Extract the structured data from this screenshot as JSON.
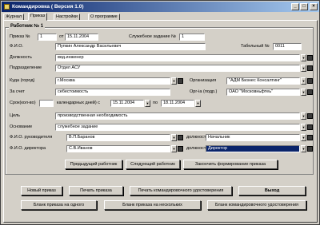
{
  "window": {
    "title": "Командировка ( Версия 1.0)"
  },
  "tabs": [
    "Журнал",
    "Приказ",
    "Настройки",
    "О программе"
  ],
  "group_title": "Работник № 1",
  "order": {
    "num_label": "Приказ №",
    "num": "1",
    "from_label": "от",
    "date": "15.11.2004",
    "task_label": "Служебное задание №",
    "task_num": "1"
  },
  "employee": {
    "fio_label": "Ф.И.О.",
    "fio": "Пупкин Александр Васильевич",
    "tab_label": "Табельный №",
    "tab_num": "0011"
  },
  "position": {
    "label": "Должность",
    "value": "вед.инженер"
  },
  "department": {
    "label": "Подразделение",
    "value": "Отдел АСУ"
  },
  "where": {
    "label": "Куда (город)",
    "value": "г.Москва",
    "org_label": "Организация",
    "org": "\"АДМ Бизнес Консалтинг\""
  },
  "payer": {
    "label": "За счет",
    "value": "себестоимость",
    "org2_label": "Орг-ia (подр.)",
    "org2": "ОАО \"Московньфтеь\""
  },
  "period": {
    "label": "Срок(кол-во)",
    "days": "",
    "days_label": "календарных дней) с",
    "from": "15.11.2004",
    "to_label": "по",
    "to": "18.11.2004"
  },
  "goal": {
    "label": "Цель",
    "value": "производственная необходимость"
  },
  "basis": {
    "label": "Основание",
    "value": "служебное задание"
  },
  "head": {
    "label": "Ф.И.О. руководителя",
    "value": "В.П.Баранов",
    "pos_label": "должность",
    "pos": "Начальник"
  },
  "director": {
    "label": "Ф.И.О. директора",
    "value": "С.В.Иванов",
    "pos_label": "должность",
    "pos": "Директор"
  },
  "nav_buttons": {
    "prev": "Предыдущий работник",
    "next": "Следующий работник",
    "finish": "Закончить формирование приказа"
  },
  "bottom_buttons": {
    "new_order": "Новый приказ",
    "print_order": "Печать приказа",
    "print_cert": "Печать командировочного удостоверения",
    "exit": "Выход",
    "blank_one": "Бланк приказа на одного",
    "blank_many": "Бланк приказа на нескольких",
    "blank_cert": "Бланк командировочного удостоверения"
  }
}
